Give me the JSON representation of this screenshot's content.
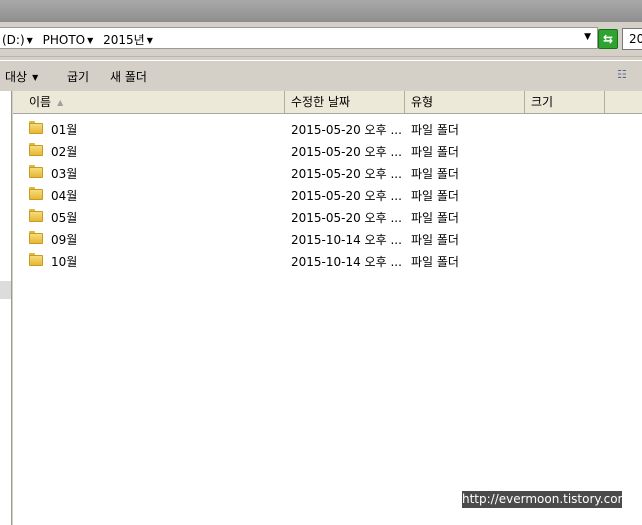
{
  "address": {
    "crumbs": [
      "(D:)",
      "PHOTO",
      "2015년"
    ],
    "search_value": "20"
  },
  "toolbar": {
    "target_label": "대상",
    "burn_label": "굽기",
    "new_folder_label": "새 폴더"
  },
  "columns": {
    "name": "이름",
    "modified": "수정한 날짜",
    "type": "유형",
    "size": "크기"
  },
  "files": [
    {
      "name": "01월",
      "modified": "2015-05-20 오후 ...",
      "type": "파일 폴더"
    },
    {
      "name": "02월",
      "modified": "2015-05-20 오후 ...",
      "type": "파일 폴더"
    },
    {
      "name": "03월",
      "modified": "2015-05-20 오후 ...",
      "type": "파일 폴더"
    },
    {
      "name": "04월",
      "modified": "2015-05-20 오후 ...",
      "type": "파일 폴더"
    },
    {
      "name": "05월",
      "modified": "2015-05-20 오후 ...",
      "type": "파일 폴더"
    },
    {
      "name": "09월",
      "modified": "2015-10-14 오후 ...",
      "type": "파일 폴더"
    },
    {
      "name": "10월",
      "modified": "2015-10-14 오후 ...",
      "type": "파일 폴더"
    }
  ],
  "watermark": "http://evermoon.tistory.com",
  "colors": {
    "refresh_green": "#2fa32f",
    "folder_yellow": "#e7b733",
    "header_bg": "#ece9d8"
  }
}
